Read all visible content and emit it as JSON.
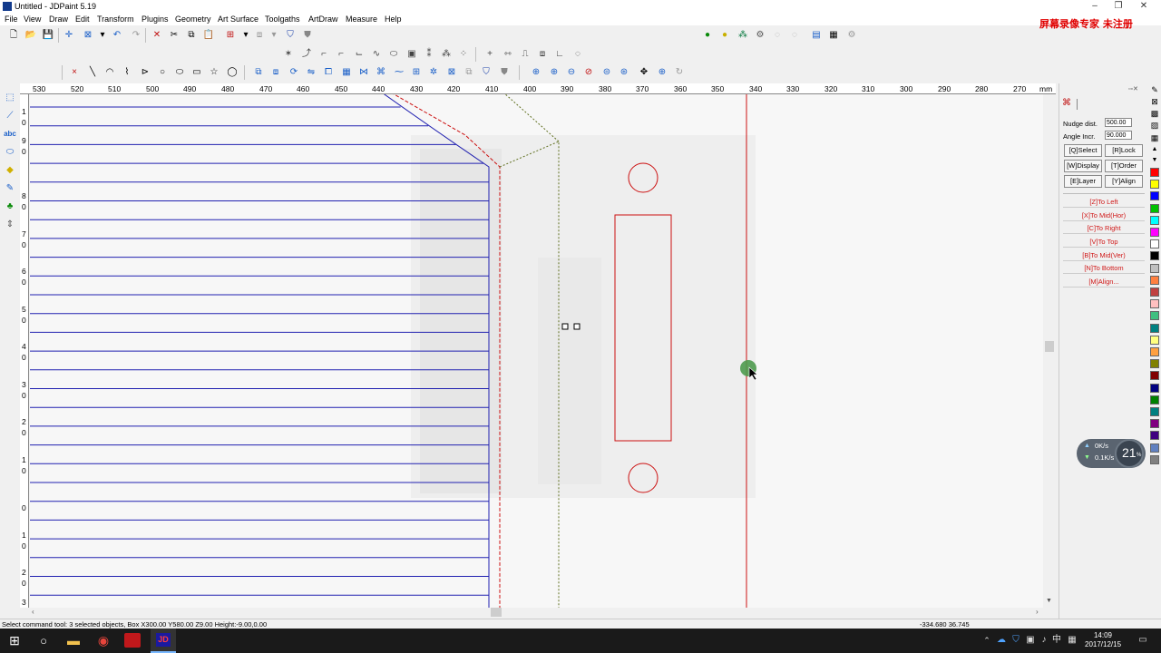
{
  "window": {
    "title": "Untitled - JDPaint 5.19"
  },
  "menu": [
    "File",
    "View",
    "Draw",
    "Edit",
    "Transform",
    "Plugins",
    "Geometry",
    "Art Surface",
    "Toolgaths",
    "ArtDraw",
    "Measure",
    "Help"
  ],
  "watermark": "屏幕录像专家  未注册",
  "ruler": {
    "h_labels": [
      "530",
      "520",
      "510",
      "500",
      "490",
      "480",
      "470",
      "460",
      "450",
      "440",
      "430",
      "420",
      "410",
      "400",
      "390",
      "380",
      "370",
      "360",
      "350",
      "340",
      "330",
      "320",
      "310",
      "300",
      "290",
      "280",
      "270"
    ],
    "unit": "mm",
    "v_labels": [
      "1",
      "0",
      "9",
      "0",
      "8",
      "0",
      "7",
      "0",
      "6",
      "0",
      "5",
      "0",
      "4",
      "0",
      "3",
      "0",
      "2",
      "0",
      "1",
      "0",
      "0",
      "1",
      "0",
      "2",
      "0",
      "3"
    ]
  },
  "panel": {
    "nudge_label": "Nudge dist.",
    "nudge_value": "500.00",
    "angle_label": "Angle Incr.",
    "angle_value": "90.000",
    "buttons": [
      "[Q]Select",
      "[R]Lock",
      "[W]Display",
      "[T]Order",
      "[E]Layer",
      "[Y]Align"
    ],
    "align": [
      "[Z]To Left",
      "[X]To Mid(Hor)",
      "[C]To Right",
      "[V]To Top",
      "[B]To Mid(Ver)",
      "[N]To Bottom",
      "[M]Align..."
    ]
  },
  "palette": [
    "#ff0000",
    "#ffff00",
    "#0000ff",
    "#00c000",
    "#00ffff",
    "#ff00ff",
    "#ffffff",
    "#000000",
    "#c0c0c0",
    "#ff8040",
    "#c04040",
    "#ffc0c0",
    "#40c080",
    "#008080",
    "#ffff80",
    "#ffa040",
    "#808000",
    "#800000",
    "#000080",
    "#008000",
    "#008080",
    "#800080",
    "#400080",
    "#6080c0",
    "#808080"
  ],
  "status": {
    "text": "Select command tool: 3 selected objects, Box X300.00 Y580.00 Z9.00 Height:-9.00,0.00",
    "coords": "-334.680 36.745"
  },
  "network": {
    "up": "0K/s",
    "down": "0.1K/s",
    "percent": "21",
    "percent_unit": "%"
  },
  "taskbar": {
    "time": "14:09",
    "date": "2017/12/15",
    "ime": "中"
  }
}
